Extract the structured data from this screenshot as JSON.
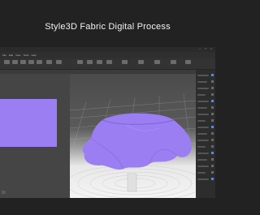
{
  "header": {
    "title": "Style3D Fabric Digital Process"
  },
  "window": {
    "menu_items": [
      "File",
      "Edit",
      "View",
      "Tools",
      "Help"
    ],
    "controls": [
      "—",
      "□",
      "×"
    ]
  },
  "toolbar": {
    "tools": [
      "tool-1",
      "tool-2",
      "tool-3",
      "tool-4",
      "tool-5",
      "tool-6",
      "tool-7",
      "tool-8",
      "tool-9",
      "tool-10"
    ]
  },
  "pattern": {
    "color": "#9b7ef2"
  },
  "scene": {
    "cloth_color": "#9b7ef2",
    "floor": "grid"
  }
}
